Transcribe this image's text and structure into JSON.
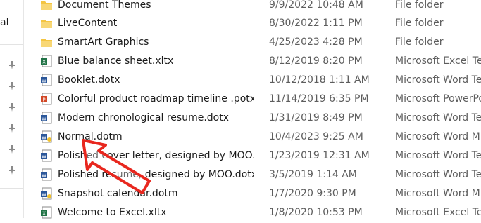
{
  "nav": {
    "partial_label": "al",
    "pinned_icons": [
      "pin-icon",
      "pin-icon",
      "pin-icon",
      "pin-icon",
      "pin-icon",
      "pin-icon"
    ]
  },
  "files": [
    {
      "name": "Document Themes",
      "date": "9/9/2022 10:48 AM",
      "type": "File folder",
      "icon": "folder-icon"
    },
    {
      "name": "LiveContent",
      "date": "8/30/2022 1:11 PM",
      "type": "File folder",
      "icon": "folder-icon"
    },
    {
      "name": "SmartArt Graphics",
      "date": "4/25/2023 4:28 PM",
      "type": "File folder",
      "icon": "folder-icon"
    },
    {
      "name": "Blue balance sheet.xltx",
      "date": "8/12/2019 8:20 PM",
      "type": "Microsoft Excel Te...",
      "icon": "excel-template-icon"
    },
    {
      "name": "Booklet.dotx",
      "date": "10/12/2018 1:11 AM",
      "type": "Microsoft Word Te...",
      "icon": "word-template-icon"
    },
    {
      "name": "Colorful product roadmap timeline .potx",
      "date": "11/14/2019 6:35 PM",
      "type": "Microsoft PowerPo...",
      "icon": "powerpoint-template-icon"
    },
    {
      "name": "Modern chronological resume.dotx",
      "date": "1/31/2019 8:49 PM",
      "type": "Microsoft Word Te...",
      "icon": "word-template-icon"
    },
    {
      "name": "Normal.dotm",
      "date": "10/4/2023 9:25 AM",
      "type": "Microsoft Word M...",
      "icon": "word-macro-template-icon"
    },
    {
      "name": "Polished cover letter, designed by MOO.d...",
      "date": "1/23/2019 12:31 AM",
      "type": "Microsoft Word Te...",
      "icon": "word-template-icon"
    },
    {
      "name": "Polished resume, designed by MOO.dotx",
      "date": "3/5/2019 1:14 AM",
      "type": "Microsoft Word Te...",
      "icon": "word-template-icon"
    },
    {
      "name": "Snapshot calendar.dotm",
      "date": "1/7/2020 9:30 PM",
      "type": "Microsoft Word M...",
      "icon": "word-macro-template-icon"
    },
    {
      "name": "Welcome to Excel.xltx",
      "date": "1/8/2020 10:53 PM",
      "type": "Microsoft Excel Te...",
      "icon": "excel-template-icon"
    }
  ],
  "colors": {
    "folder": "#f4c542",
    "word": "#2b579a",
    "excel": "#217346",
    "powerpoint": "#d24726",
    "annotation_arrow": "#e8271e"
  }
}
